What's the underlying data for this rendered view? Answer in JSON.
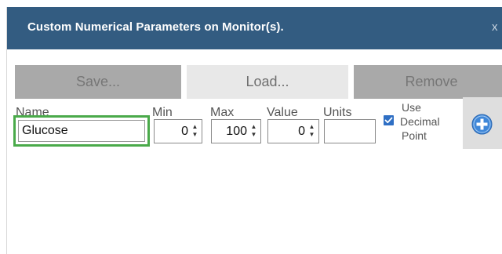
{
  "dialog": {
    "title": "Custom Numerical Parameters on Monitor(s).",
    "close_glyph": "x"
  },
  "toolbar": {
    "save_label": "Save...",
    "load_label": "Load...",
    "remove_label": "Remove"
  },
  "columns": {
    "name": "Name",
    "min": "Min",
    "max": "Max",
    "value": "Value",
    "units": "Units"
  },
  "row": {
    "name": "Glucose",
    "min": "0",
    "max": "100",
    "value": "0",
    "units": ""
  },
  "decimal_option": {
    "line1": "Use",
    "line2": "Decimal",
    "line3": "Point",
    "checked": true
  },
  "icons": {
    "add": "add-circle-icon",
    "close": "close-icon",
    "checkbox": "checkmark-icon",
    "spinner": "spin-arrows-icon"
  },
  "colors": {
    "titlebar": "#335c81",
    "focus_outline": "#4aaa4a",
    "button_dark": "#a9a9a9",
    "button_light": "#e8e8e8",
    "checkbox": "#2f6fc4",
    "add_icon": "#3f87d8"
  }
}
